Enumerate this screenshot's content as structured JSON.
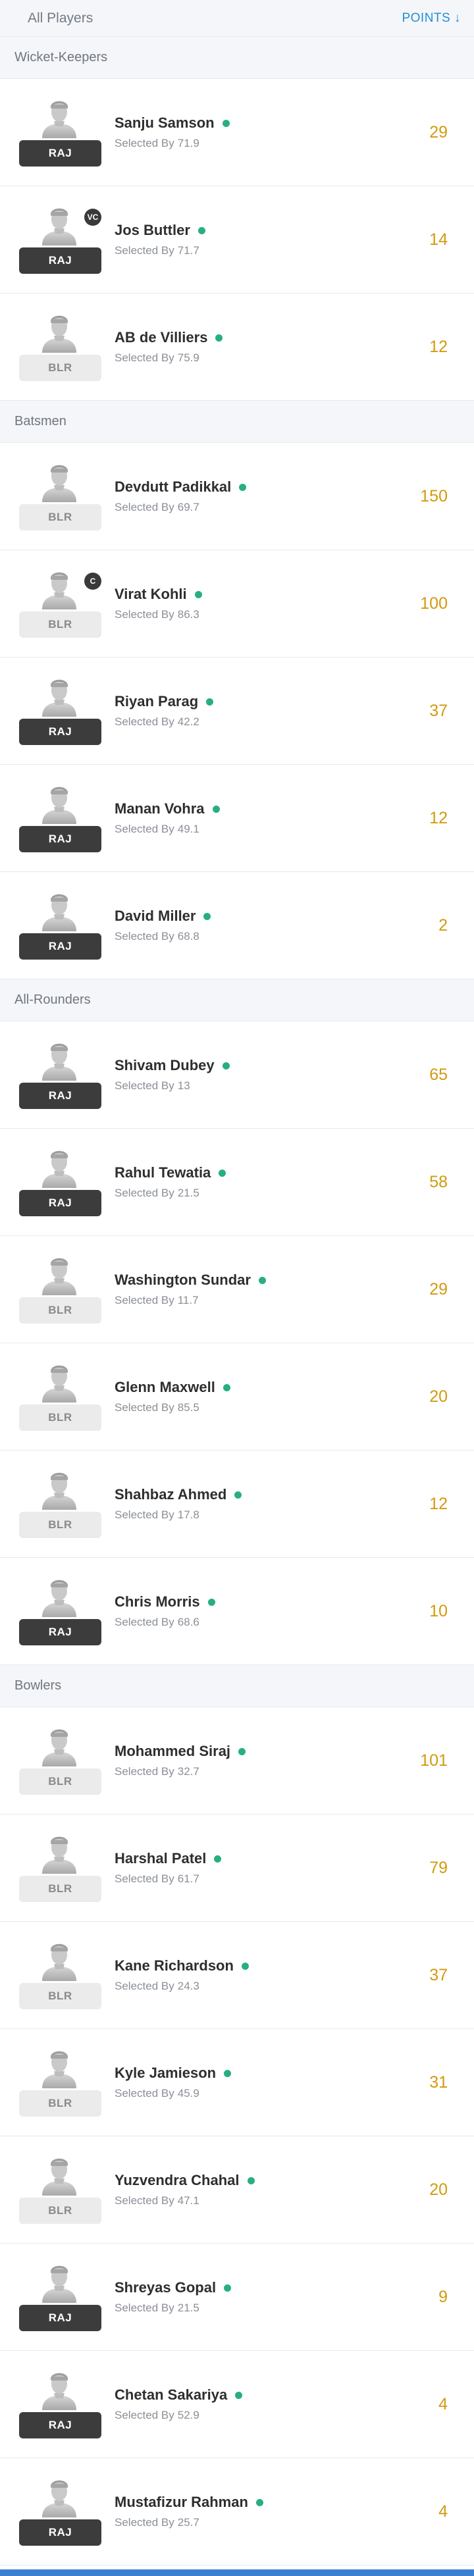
{
  "header": {
    "title": "All Players",
    "sort_label": "POINTS ↓"
  },
  "selected_by_label": "Selected By",
  "sections": [
    {
      "title": "Wicket-Keepers",
      "players": [
        {
          "name": "Sanju Samson",
          "team": "RAJ",
          "team_style": "dark",
          "role": "",
          "selected_by": "71.9",
          "points": "29"
        },
        {
          "name": "Jos Buttler",
          "team": "RAJ",
          "team_style": "dark",
          "role": "VC",
          "selected_by": "71.7",
          "points": "14"
        },
        {
          "name": "AB de Villiers",
          "team": "BLR",
          "team_style": "light",
          "role": "",
          "selected_by": "75.9",
          "points": "12"
        }
      ]
    },
    {
      "title": "Batsmen",
      "players": [
        {
          "name": "Devdutt Padikkal",
          "team": "BLR",
          "team_style": "light",
          "role": "",
          "selected_by": "69.7",
          "points": "150"
        },
        {
          "name": "Virat Kohli",
          "team": "BLR",
          "team_style": "light",
          "role": "C",
          "selected_by": "86.3",
          "points": "100"
        },
        {
          "name": "Riyan Parag",
          "team": "RAJ",
          "team_style": "dark",
          "role": "",
          "selected_by": "42.2",
          "points": "37"
        },
        {
          "name": "Manan Vohra",
          "team": "RAJ",
          "team_style": "dark",
          "role": "",
          "selected_by": "49.1",
          "points": "12"
        },
        {
          "name": "David Miller",
          "team": "RAJ",
          "team_style": "dark",
          "role": "",
          "selected_by": "68.8",
          "points": "2"
        }
      ]
    },
    {
      "title": "All-Rounders",
      "players": [
        {
          "name": "Shivam Dubey",
          "team": "RAJ",
          "team_style": "dark",
          "role": "",
          "selected_by": "13",
          "points": "65"
        },
        {
          "name": "Rahul Tewatia",
          "team": "RAJ",
          "team_style": "dark",
          "role": "",
          "selected_by": "21.5",
          "points": "58"
        },
        {
          "name": "Washington Sundar",
          "team": "BLR",
          "team_style": "light",
          "role": "",
          "selected_by": "11.7",
          "points": "29"
        },
        {
          "name": "Glenn Maxwell",
          "team": "BLR",
          "team_style": "light",
          "role": "",
          "selected_by": "85.5",
          "points": "20"
        },
        {
          "name": "Shahbaz Ahmed",
          "team": "BLR",
          "team_style": "light",
          "role": "",
          "selected_by": "17.8",
          "points": "12"
        },
        {
          "name": "Chris Morris",
          "team": "RAJ",
          "team_style": "dark",
          "role": "",
          "selected_by": "68.6",
          "points": "10"
        }
      ]
    },
    {
      "title": "Bowlers",
      "players": [
        {
          "name": "Mohammed Siraj",
          "team": "BLR",
          "team_style": "light",
          "role": "",
          "selected_by": "32.7",
          "points": "101"
        },
        {
          "name": "Harshal Patel",
          "team": "BLR",
          "team_style": "light",
          "role": "",
          "selected_by": "61.7",
          "points": "79"
        },
        {
          "name": "Kane Richardson",
          "team": "BLR",
          "team_style": "light",
          "role": "",
          "selected_by": "24.3",
          "points": "37"
        },
        {
          "name": "Kyle Jamieson",
          "team": "BLR",
          "team_style": "light",
          "role": "",
          "selected_by": "45.9",
          "points": "31"
        },
        {
          "name": "Yuzvendra Chahal",
          "team": "BLR",
          "team_style": "light",
          "role": "",
          "selected_by": "47.1",
          "points": "20"
        },
        {
          "name": "Shreyas Gopal",
          "team": "RAJ",
          "team_style": "dark",
          "role": "",
          "selected_by": "21.5",
          "points": "9"
        },
        {
          "name": "Chetan Sakariya",
          "team": "RAJ",
          "team_style": "dark",
          "role": "",
          "selected_by": "52.9",
          "points": "4"
        },
        {
          "name": "Mustafizur Rahman",
          "team": "RAJ",
          "team_style": "dark",
          "role": "",
          "selected_by": "25.7",
          "points": "4"
        }
      ]
    }
  ],
  "colors": {
    "points": "#d39a0d",
    "playing_dot": "#27b07c",
    "sort_link": "#1f8fd6",
    "team_dark": "#3c3c3c",
    "team_light": "#ebebeb"
  }
}
